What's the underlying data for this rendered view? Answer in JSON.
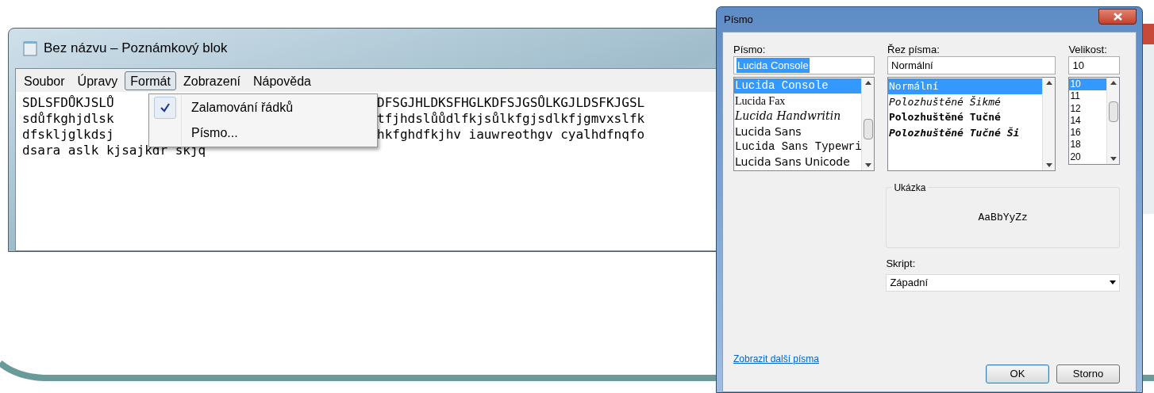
{
  "notepad": {
    "title": "Bez názvu – Poznámkový blok",
    "menu": [
      {
        "label": "Soubor",
        "selected": false
      },
      {
        "label": "Úpravy",
        "selected": false
      },
      {
        "label": "Formát",
        "selected": true
      },
      {
        "label": "Zobrazení",
        "selected": false
      },
      {
        "label": "Nápověda",
        "selected": false
      }
    ],
    "dropdown": [
      {
        "label": "Zalamování řádků",
        "checked": true
      },
      {
        "label": "Písmo...",
        "checked": false
      }
    ],
    "lines": [
      {
        "before": "SDLSFDŮKJSLŮ",
        "after": "DFSGJHLDKSFHGLKDFSJGSŮLKGJLDSFKJGSL"
      },
      {
        "before": "sdůfkghjdlsk",
        "after": "tfjhdslůůdlfkjsůlkfgjsdlkfjgmvxslfk"
      },
      {
        "before": "dfskljglkdsj",
        "after": "hkfghdfkjhv iauwreothgv cyalhdfnqfo"
      },
      {
        "before": "dsara aslk kjsajkdr skjq"
      }
    ]
  },
  "dialog": {
    "title": "Písmo",
    "font": {
      "label": "Písmo:",
      "value": "Lucida Console",
      "highlighted": true,
      "items": [
        {
          "label": "Lucida Console",
          "kind": "mono",
          "selected": true
        },
        {
          "label": "Lucida Fax",
          "kind": "serif",
          "selected": false
        },
        {
          "label": "Lucida Handwritin",
          "kind": "script",
          "selected": false
        },
        {
          "label": "Lucida Sans",
          "kind": "sans",
          "selected": false
        },
        {
          "label": "Lucida Sans Typewri",
          "kind": "mono",
          "selected": false
        },
        {
          "label": "Lucida Sans Unicode",
          "kind": "sans",
          "selected": false
        }
      ]
    },
    "style": {
      "label": "Řez písma:",
      "value": "Normální",
      "highlighted": false,
      "items": [
        {
          "label": "Normální",
          "kind": "regular",
          "selected": true
        },
        {
          "label": "Polozhuštěné Šikmé",
          "kind": "italic",
          "selected": false
        },
        {
          "label": "Polozhuštěné Tučné",
          "kind": "bold",
          "selected": false
        },
        {
          "label": "Polozhuštěné Tučné Ši",
          "kind": "bold-italic",
          "selected": false
        }
      ]
    },
    "size": {
      "label": "Velikost:",
      "value": "10",
      "highlighted": false,
      "items": [
        {
          "label": "10",
          "selected": true
        },
        {
          "label": "11",
          "selected": false
        },
        {
          "label": "12",
          "selected": false
        },
        {
          "label": "14",
          "selected": false
        },
        {
          "label": "16",
          "selected": false
        },
        {
          "label": "18",
          "selected": false
        },
        {
          "label": "20",
          "selected": false
        }
      ]
    },
    "sample": {
      "label": "Ukázka",
      "text": "AaBbYyZz"
    },
    "script": {
      "label": "Skript:",
      "value": "Západní"
    },
    "link": "Zobrazit další písma",
    "buttons": [
      {
        "label": "OK",
        "default": true
      },
      {
        "label": "Storno",
        "default": false
      }
    ]
  }
}
